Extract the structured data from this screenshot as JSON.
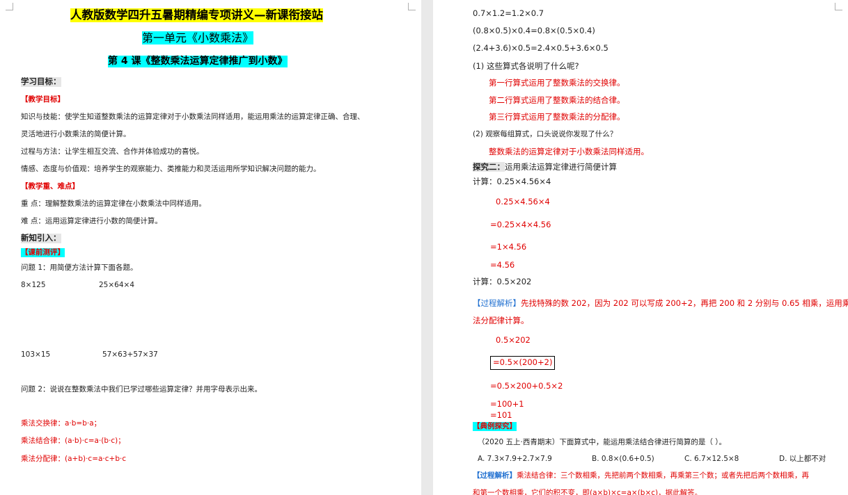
{
  "left": {
    "title": "人教版数学四升五暑期精编专项讲义—新课衔接站",
    "unit": "第一单元《小数乘法》",
    "lesson": "第 4 课《整数乘法运算定律推广到小数》",
    "goals_heading": "学习目标：",
    "teaching_goals_tag": "【教学目标】",
    "goal_1a": "知识与技能：使学生知道整数乘法的运算定律对于小数乘法同样适用，能运用乘法的运算定律正确、合理、",
    "goal_1b": "灵活地进行小数乘法的简便计算。",
    "goal_2": "过程与方法：让学生相互交流、合作并体验成功的喜悦。",
    "goal_3": "情感、态度与价值观：培养学生的观察能力、类推能力和灵活运用所学知识解决问题的能力。",
    "key_tag": "【教学重、难点】",
    "key_point": "重 点：理解整数乘法的运算定律在小数乘法中同样适用。",
    "hard_point": "难 点：运用运算定律进行小数的简便计算。",
    "new_knowledge": "新知引入：",
    "pretest_tag": "【课前测评】",
    "q1": "问题 1：用简便方法计算下面各题。",
    "expr_1": "8×125",
    "expr_2": "25×64×4",
    "expr_3": "103×15",
    "expr_4": "57×63+57×37",
    "q2": "问题 2：说说在整数乘法中我们已学过哪些运算定律？并用字母表示出来。",
    "law_1": "乘法交换律：a·b=b·a；",
    "law_2": "乘法结合律：(a·b)·c=a·(b·c)；",
    "law_3": "乘法分配律：(a+b)·c=a·c+b·c"
  },
  "right": {
    "line_1": "0.7×1.2=1.2×0.7",
    "line_2": "(0.8×0.5)×0.4=0.8×(0.5×0.4)",
    "line_3": "(2.4+3.6)×0.5=2.4×0.5+3.6×0.5",
    "q_1": "(1) 这些算式各说明了什么呢?",
    "ans_1": "第一行算式运用了整数乘法的交换律。",
    "ans_2": "第二行算式运用了整数乘法的结合律。",
    "ans_3": "第三行算式运用了整数乘法的分配律。",
    "q_2": "(2) 观察每组算式，口头说说你发现了什么？",
    "ans_4": "整数乘法的运算定律对于小数乘法同样适用。",
    "explore_label": "探究二：",
    "explore_text": "运用乘法运算定律进行简便计算",
    "calc_1": "计算：0.25×4.56×4",
    "step_1": "0.25×4.56×4",
    "step_2": "=0.25×4×4.56",
    "step_3": "=1×4.56",
    "step_4": "=4.56",
    "calc_2": "计算：0.5×202",
    "analysis_tag": "【过程解析】",
    "analysis_text_a": "先找特殊的数 202，因为 202 可以写成 200+2，再把 200 和 2 分别与 0.65 相乘，运用乘",
    "analysis_text_b": "法分配律计算。",
    "s_1": "0.5×202",
    "s_2": "=0.5×(200+2)",
    "s_3": "=0.5×200+0.5×2",
    "s_4": "=100+1",
    "s_5": "=101",
    "example_tag": "【典例探究】",
    "example_q": "（2020 五上·西青期末）下面算式中，能运用乘法结合律进行简算的是（        ）。",
    "opt_a": "A.  7.3×7.9+2.7×7.9",
    "opt_b": "B.  0.8×(0.6+0.5)",
    "opt_c": "C.  6.7×12.5×8",
    "opt_d": "D.  以上都不对",
    "analysis2_tag": "【过程解析】",
    "analysis2_text": "乘法结合律：三个数相乘，先把前两个数相乘，再乘第三个数；或者先把后两个数相乘，再",
    "analysis2_text_b": "和第一个数相乘，它们的积不变，即(a×b)×c=a×(b×c)，据此解答。"
  },
  "colors": {
    "red": "#e00000",
    "blue": "#1f6fd0",
    "yellow": "#ffff00",
    "cyan": "#00ffff"
  }
}
